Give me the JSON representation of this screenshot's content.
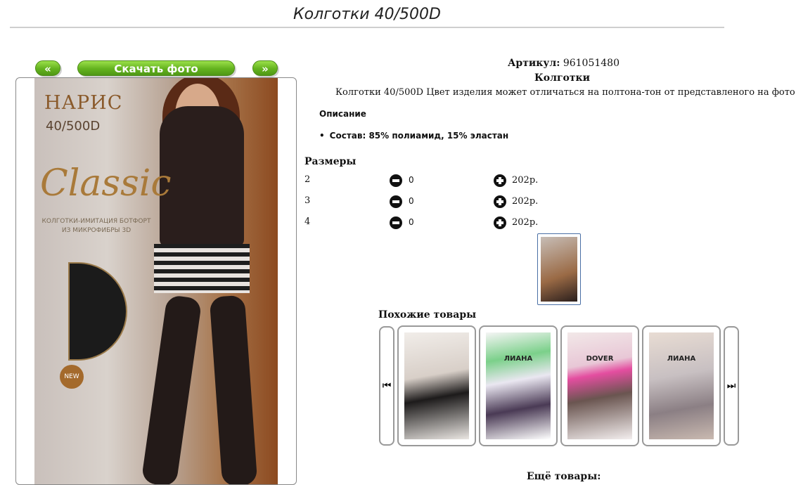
{
  "page": {
    "title": "Колготки 40/500D"
  },
  "photo_nav": {
    "prev_label": "«",
    "download_label": "Скачать фото",
    "next_label": "»"
  },
  "package": {
    "brand": "НАРИС",
    "density": "40/500D",
    "line": "Classic",
    "description": "КОЛГОТКИ-ИМИТАЦИЯ БОТФОРТ ИЗ МИКРОФИБРЫ 3D",
    "badge": "NEW"
  },
  "product": {
    "article_label": "Артикул:",
    "article_value": "961051480",
    "type": "Колготки",
    "description": "Колготки 40/500D Цвет изделия может отличаться на полтона-тон от представленого на фото",
    "description_heading": "Описание",
    "composition": "Состав: 85% полиамид, 15% эластан"
  },
  "sizes": {
    "heading": "Размеры",
    "rows": [
      {
        "size": "2",
        "qty": "0",
        "price": "202р."
      },
      {
        "size": "3",
        "qty": "0",
        "price": "202р."
      },
      {
        "size": "4",
        "qty": "0",
        "price": "202р."
      }
    ]
  },
  "similar": {
    "heading": "Похожие товары",
    "items": [
      {
        "label": ""
      },
      {
        "label": "ЛИАНА"
      },
      {
        "label": "DOVER"
      },
      {
        "label": "ЛИАНА"
      }
    ]
  },
  "more": {
    "heading": "Ещё товары:"
  },
  "icons": {
    "minus": "minus-circle-icon",
    "plus": "plus-circle-icon",
    "first": "skip-first-icon",
    "last": "skip-last-icon"
  },
  "colors": {
    "accent_green": "#63b21e",
    "border_blue": "#4a6fa5"
  }
}
